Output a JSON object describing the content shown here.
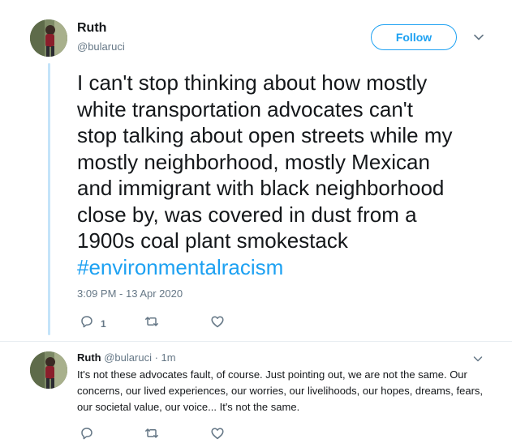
{
  "main_tweet": {
    "author_name": "Ruth",
    "author_handle": "@bularuci",
    "follow_label": "Follow",
    "text": "I can't stop thinking about how mostly\nwhite transportation advocates can't\nstop talking about open streets while my\nmostly neighborhood, mostly Mexican\nand immigrant with black neighborhood\nclose by, was covered in dust from a\n1900s coal plant smokestack\n",
    "hashtag": "#environmentalracism",
    "timestamp": "3:09 PM - 13 Apr 2020",
    "reply_count": "1",
    "icons": [
      "reply-icon",
      "retweet-icon",
      "like-icon",
      "chevron-down-icon"
    ]
  },
  "reply_tweet": {
    "author_name": "Ruth",
    "author_handle": "@bularuci",
    "separator": " · ",
    "time": "1m",
    "text": "It's not these advocates fault, of course. Just pointing out, we are not the same. Our concerns, our lived experiences, our worries, our livelihoods, our hopes, dreams, fears, our societal value, our voice... It's not the same.",
    "icons": [
      "reply-icon",
      "retweet-icon",
      "like-icon",
      "chevron-down-icon"
    ]
  },
  "colors": {
    "accent": "#1da1f2",
    "text": "#14171a",
    "muted": "#657786",
    "thread_line": "#c4e4f9",
    "divider": "#e6ecf0"
  }
}
